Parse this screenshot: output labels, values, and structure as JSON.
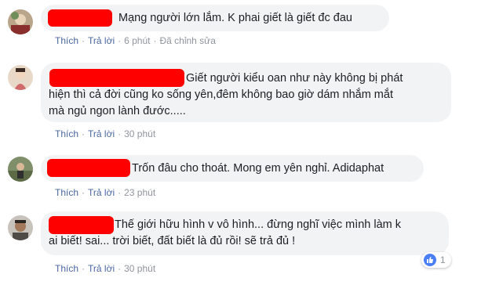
{
  "actions": {
    "like": "Thích",
    "reply": "Trả lời",
    "separator": "·"
  },
  "comments": [
    {
      "text": "Mạng người lớn lắm. K phai giết là giết đc đau",
      "time": "6 phút",
      "edited": "Đã chỉnh sửa"
    },
    {
      "text": "Giết người kiểu oan như này không bị phát\nhiện thì cả đời cũng ko sống yên,đêm không bao giờ dám nhắm mắt\nmà ngủ ngon lành đước.....",
      "time": "30 phút"
    },
    {
      "text": "Trốn đâu cho thoát. Mong em yên nghỉ. Adidaphat",
      "time": "23 phút"
    },
    {
      "text": "Thế giới hữu hình v vô hình... đừng nghĩ việc mình làm k\nai biết! sai... trời biết, đất biết là đủ rồi! sẽ trả đủ !",
      "time": "30 phút",
      "reaction_count": "1",
      "reaction_icon": "like-icon"
    }
  ],
  "colors": {
    "redaction": "#ff0000",
    "bubble": "#f2f3f5",
    "link": "#4b67a1",
    "meta": "#90949c",
    "like": "#4a7ef3"
  }
}
